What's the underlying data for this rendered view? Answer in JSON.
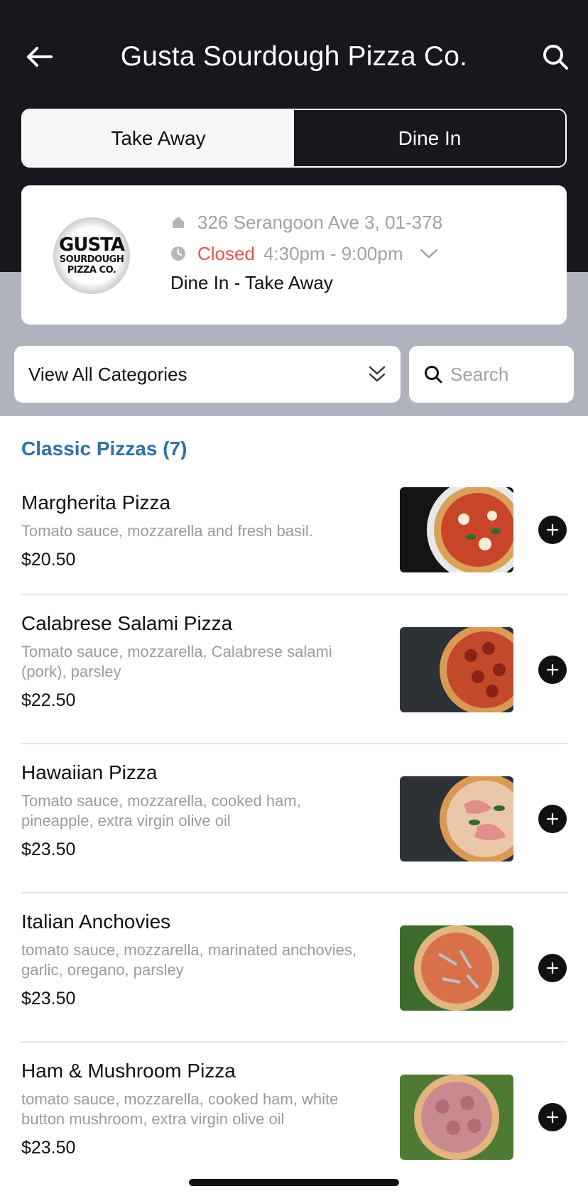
{
  "header": {
    "title": "Gusta Sourdough Pizza Co.",
    "back_icon": "arrow-left-icon",
    "search_icon": "search-icon"
  },
  "order_type": {
    "options": [
      "Take Away",
      "Dine In"
    ],
    "selected": "Take Away"
  },
  "store": {
    "logo_text": [
      "GUSTA",
      "SOURDOUGH",
      "PIZZA CO."
    ],
    "address": "326 Serangoon Ave 3, 01-378",
    "status": "Closed",
    "hours": "4:30pm - 9:00pm",
    "modes": "Dine In - Take Away"
  },
  "filters": {
    "category_label": "View All Categories",
    "search_placeholder": "Search"
  },
  "section": {
    "title": "Classic Pizzas (7)"
  },
  "items": [
    {
      "name": "Margherita Pizza",
      "desc": "Tomato sauce, mozzarella and fresh basil.",
      "price": "$20.50"
    },
    {
      "name": "Calabrese Salami Pizza",
      "desc": "Tomato sauce, mozzarella, Calabrese salami (pork), parsley",
      "price": "$22.50"
    },
    {
      "name": "Hawaiian Pizza",
      "desc": "Tomato sauce, mozzarella, cooked ham, pineapple, extra virgin olive oil",
      "price": "$23.50"
    },
    {
      "name": "Italian Anchovies",
      "desc": "tomato sauce, mozzarella, marinated anchovies, garlic, oregano, parsley",
      "price": "$23.50"
    },
    {
      "name": "Ham & Mushroom Pizza",
      "desc": "tomato sauce, mozzarella, cooked ham, white button mushroom, extra virgin olive oil",
      "price": "$23.50"
    }
  ],
  "colors": {
    "hero_bg": "#17181d",
    "band_bg": "#b0b3bd",
    "section_title": "#2d72a6",
    "closed": "#e2554f"
  }
}
